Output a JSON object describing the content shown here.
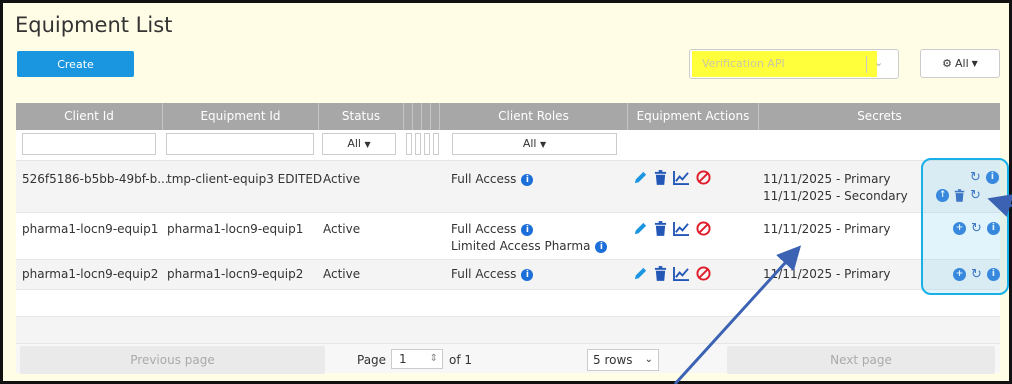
{
  "page": {
    "title": "Equipment List",
    "create_label": "Create",
    "verification_select": "Verification API",
    "all_filter_label": "All"
  },
  "table": {
    "columns": [
      "Client Id",
      "Equipment Id",
      "Status",
      "Client Roles",
      "Equipment Actions",
      "Secrets"
    ],
    "status_filter": "All",
    "roles_filter": "All",
    "rows": [
      {
        "client_id": "526f5186-b5bb-49bf-b...",
        "equipment_id": "tmp-client-equip3 EDITED",
        "status": "Active",
        "roles": [
          "Full Access"
        ],
        "secrets": [
          "11/11/2025 - Primary",
          "11/11/2025 - Secondary"
        ]
      },
      {
        "client_id": "pharma1-locn9-equip1",
        "equipment_id": "pharma1-locn9-equip1",
        "status": "Active",
        "roles": [
          "Full Access",
          "Limited Access Pharma"
        ],
        "secrets": [
          "11/11/2025 - Primary"
        ]
      },
      {
        "client_id": "pharma1-locn9-equip2",
        "equipment_id": "pharma1-locn9-equip2",
        "status": "Active",
        "roles": [
          "Full Access"
        ],
        "secrets": [
          "11/11/2025 - Primary"
        ]
      }
    ]
  },
  "pagination": {
    "previous_label": "Previous page",
    "page_label": "Page",
    "page_value": "1",
    "of_label": "of 1",
    "rows_value": "5 rows",
    "next_label": "Next page"
  },
  "colors": {
    "accent": "#1a96e0",
    "header_bg": "#a7a7a7",
    "highlight_yellow": "#ffff3c",
    "annotation_box": "#17b0e8",
    "annotation_arrow": "#3b62b3"
  }
}
